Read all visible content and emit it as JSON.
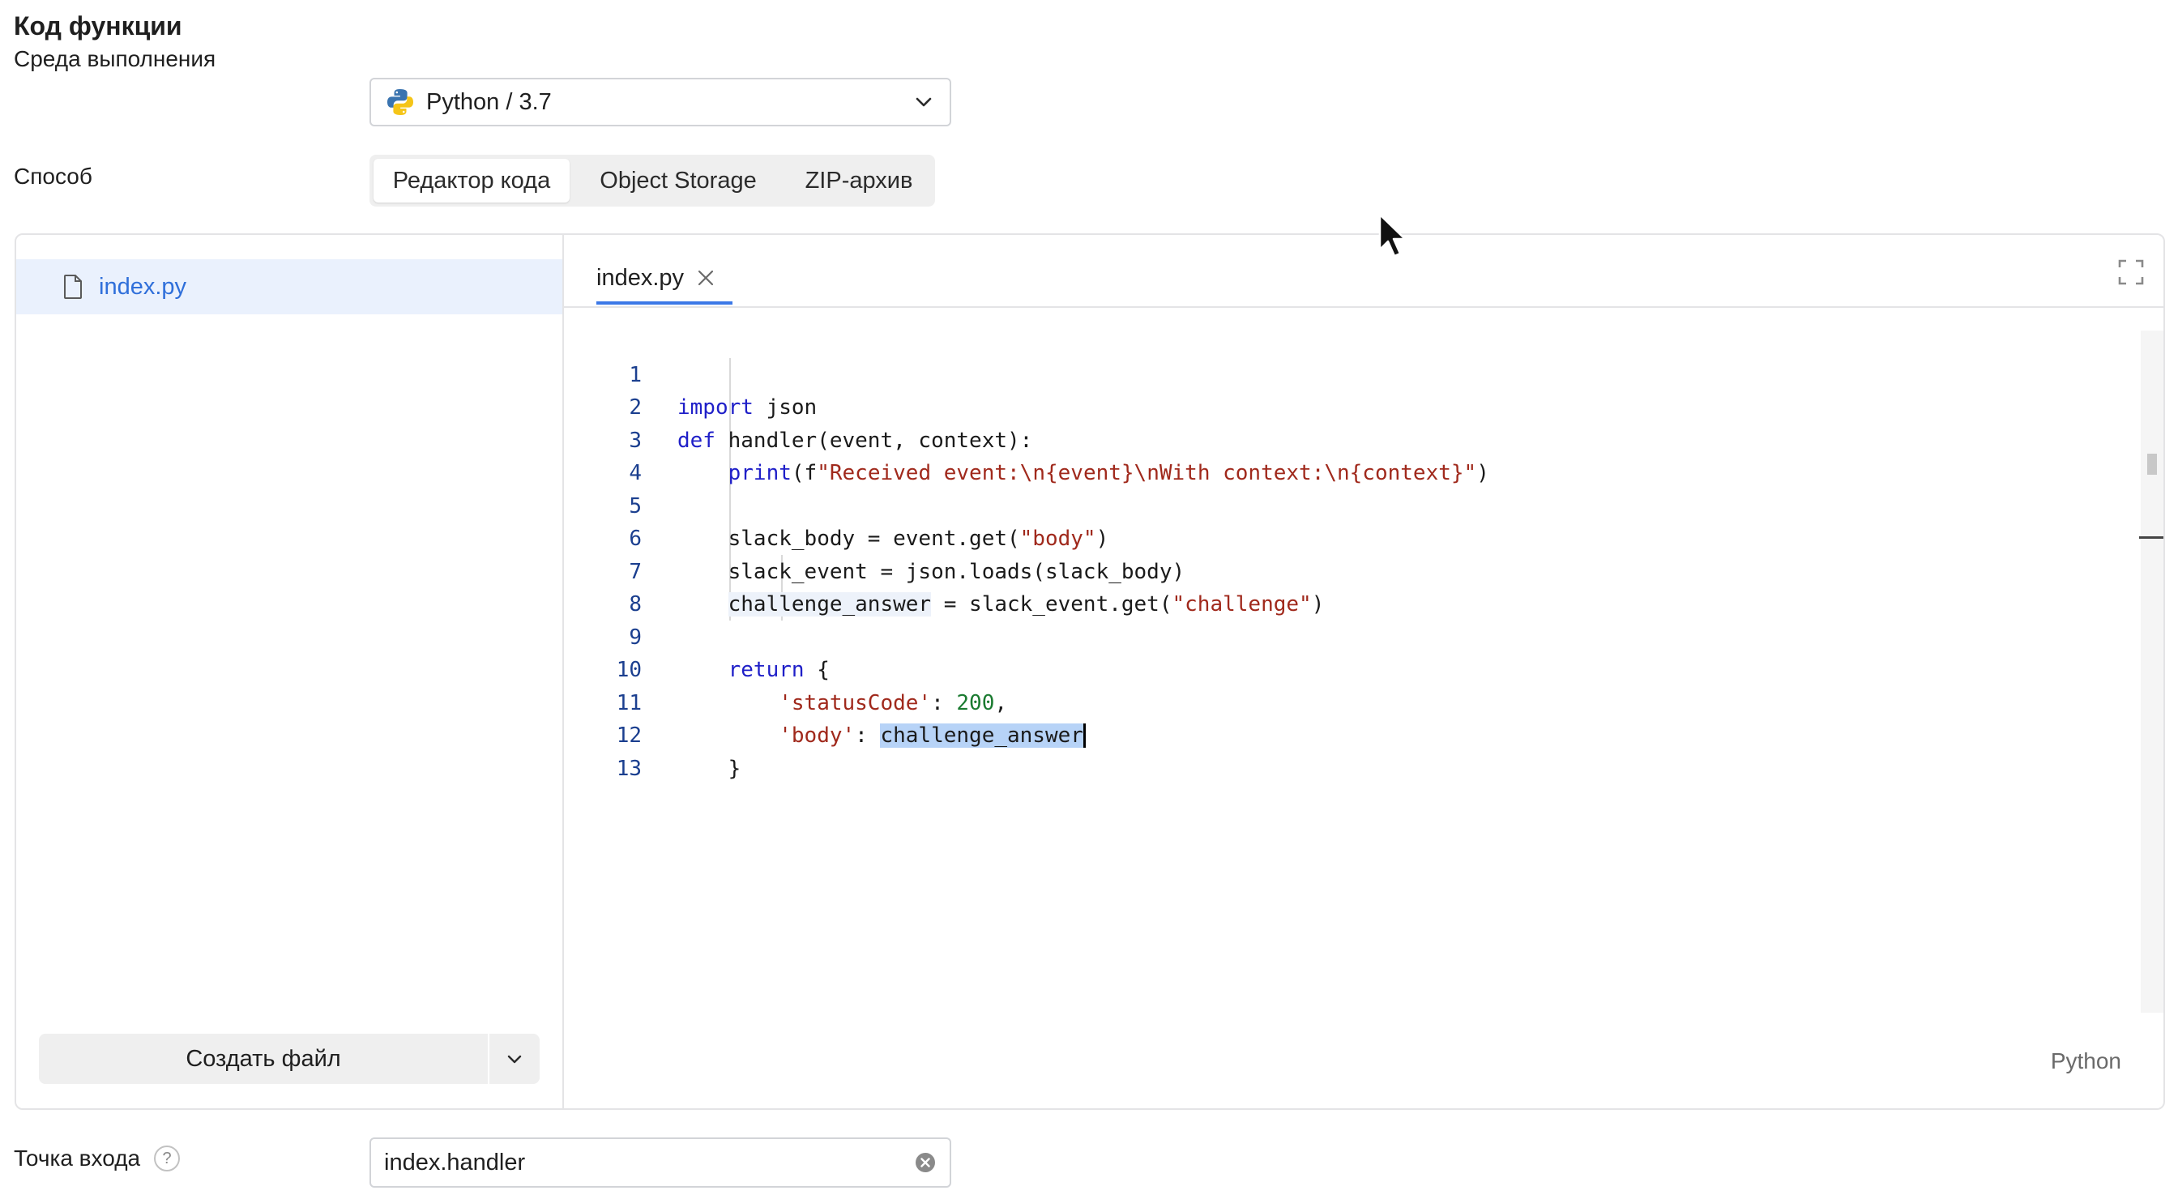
{
  "header": {
    "title": "Код функции"
  },
  "runtime": {
    "label": "Среда выполнения",
    "value": "Python / 3.7",
    "icon": "python-logo-icon"
  },
  "method": {
    "label": "Способ",
    "options": [
      "Редактор кода",
      "Object Storage",
      "ZIP-архив"
    ],
    "selected": "Редактор кода"
  },
  "files": {
    "items": [
      {
        "name": "index.py",
        "icon": "file-icon"
      }
    ],
    "create_label": "Создать файл"
  },
  "editor": {
    "tab": "index.py",
    "language": "Python",
    "lines": [
      {
        "num": "1"
      },
      {
        "num": "2"
      },
      {
        "num": "3"
      },
      {
        "num": "4"
      },
      {
        "num": "5"
      },
      {
        "num": "6"
      },
      {
        "num": "7"
      },
      {
        "num": "8"
      },
      {
        "num": "9"
      },
      {
        "num": "10"
      },
      {
        "num": "11"
      },
      {
        "num": "12"
      },
      {
        "num": "13"
      }
    ],
    "code": {
      "l1_kw": "import",
      "l1_rest": " json",
      "l2_kw": "def",
      "l2_rest": " handler(event, context):",
      "l3_indent": "    ",
      "l3_fn": "print",
      "l3_open": "(f",
      "l3_str": "\"Received event:\\n{event}\\nWith context:\\n{context}\"",
      "l3_close": ")",
      "l5_indent": "    ",
      "l5_code": "slack_body = event.get(",
      "l5_str": "\"body\"",
      "l5_close": ")",
      "l6_indent": "    ",
      "l6_code": "slack_event = json.loads(slack_body)",
      "l7_indent": "    ",
      "l7_hl": "challenge_answer",
      "l7_code": " = slack_event.get(",
      "l7_str": "\"challenge\"",
      "l7_close": ")",
      "l9_indent": "    ",
      "l9_kw": "return",
      "l9_rest": " {",
      "l10_indent": "        ",
      "l10_str": "'statusCode'",
      "l10_mid": ": ",
      "l10_num": "200",
      "l10_end": ",",
      "l11_indent": "        ",
      "l11_str": "'body'",
      "l11_mid": ": ",
      "l11_sel": "challenge_answer",
      "l12_indent": "    ",
      "l12_code": "}"
    }
  },
  "entry_point": {
    "label": "Точка входа",
    "help": "?",
    "value": "index.handler"
  }
}
